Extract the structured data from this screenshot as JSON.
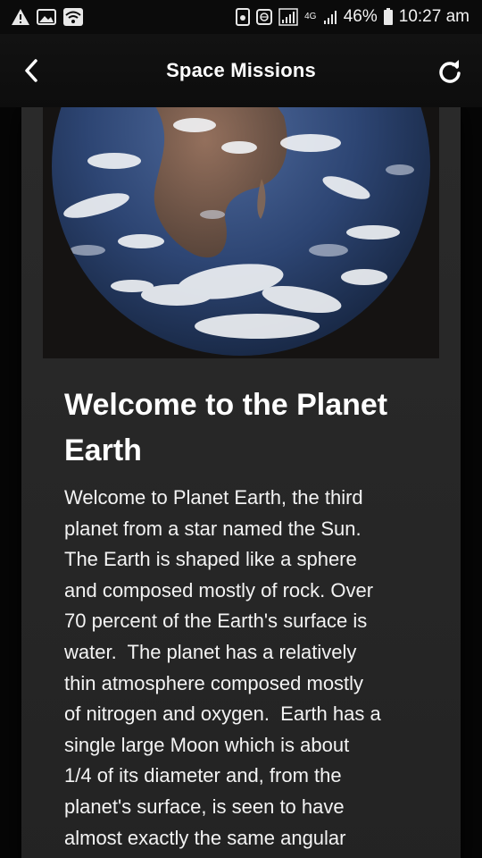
{
  "status_bar": {
    "battery_percent": "46%",
    "time": "10:27 am",
    "network_label": "4G",
    "icons": [
      "warning-icon",
      "image-icon",
      "wifi-icon",
      "recycle-icon",
      "globe-icon",
      "signal-icon",
      "signal-icon",
      "battery-icon"
    ]
  },
  "header": {
    "title": "Space Missions",
    "back_icon": "chevron-left-icon",
    "refresh_icon": "refresh-icon"
  },
  "article": {
    "title": "Welcome to the Planet Earth",
    "body": "Welcome to Planet Earth, the third\nplanet from a star named the Sun.\nThe Earth is shaped like a sphere\nand composed mostly of rock. Over\n70 percent of the Earth's surface is\nwater.  The planet has a relatively\nthin atmosphere composed mostly\nof nitrogen and oxygen.  Earth has a\nsingle large Moon which is about\n1/4 of its diameter and, from the\nplanet's surface, is seen to have\nalmost exactly the same angular"
  },
  "colors": {
    "background": "#060606",
    "header": "#111111",
    "card": "#282828",
    "text": "#ffffff"
  }
}
